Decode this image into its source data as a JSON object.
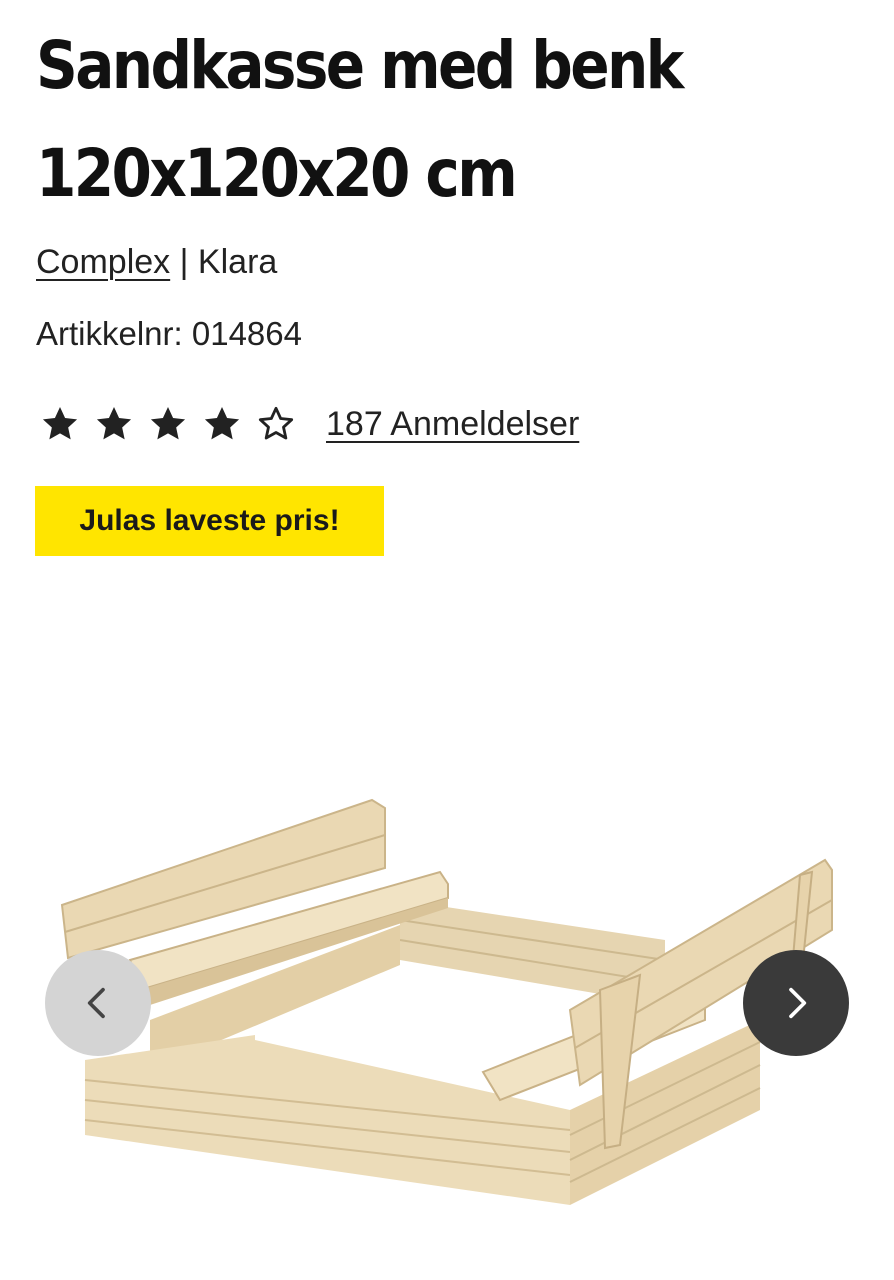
{
  "product": {
    "title": "Sandkasse med benk 120x120x20 cm",
    "brand": "Complex",
    "brand_separator": "|",
    "series": "Klara",
    "article_label": "Artikkelnr:",
    "article_number": "014864",
    "article_text": "Artikkelnr: 014864"
  },
  "rating": {
    "value": 4,
    "max": 5,
    "reviews_label": "187 Anmeldelser",
    "filled_color": "#222222"
  },
  "promo": {
    "label": "Julas laveste pris!",
    "background": "#ffe500"
  },
  "gallery": {
    "image_icon": "sandbox-with-bench-image",
    "prev_icon": "chevron-left-icon",
    "next_icon": "chevron-right-icon",
    "prev_button_color": "#d4d4d4",
    "next_button_color": "#3a3a3a"
  }
}
